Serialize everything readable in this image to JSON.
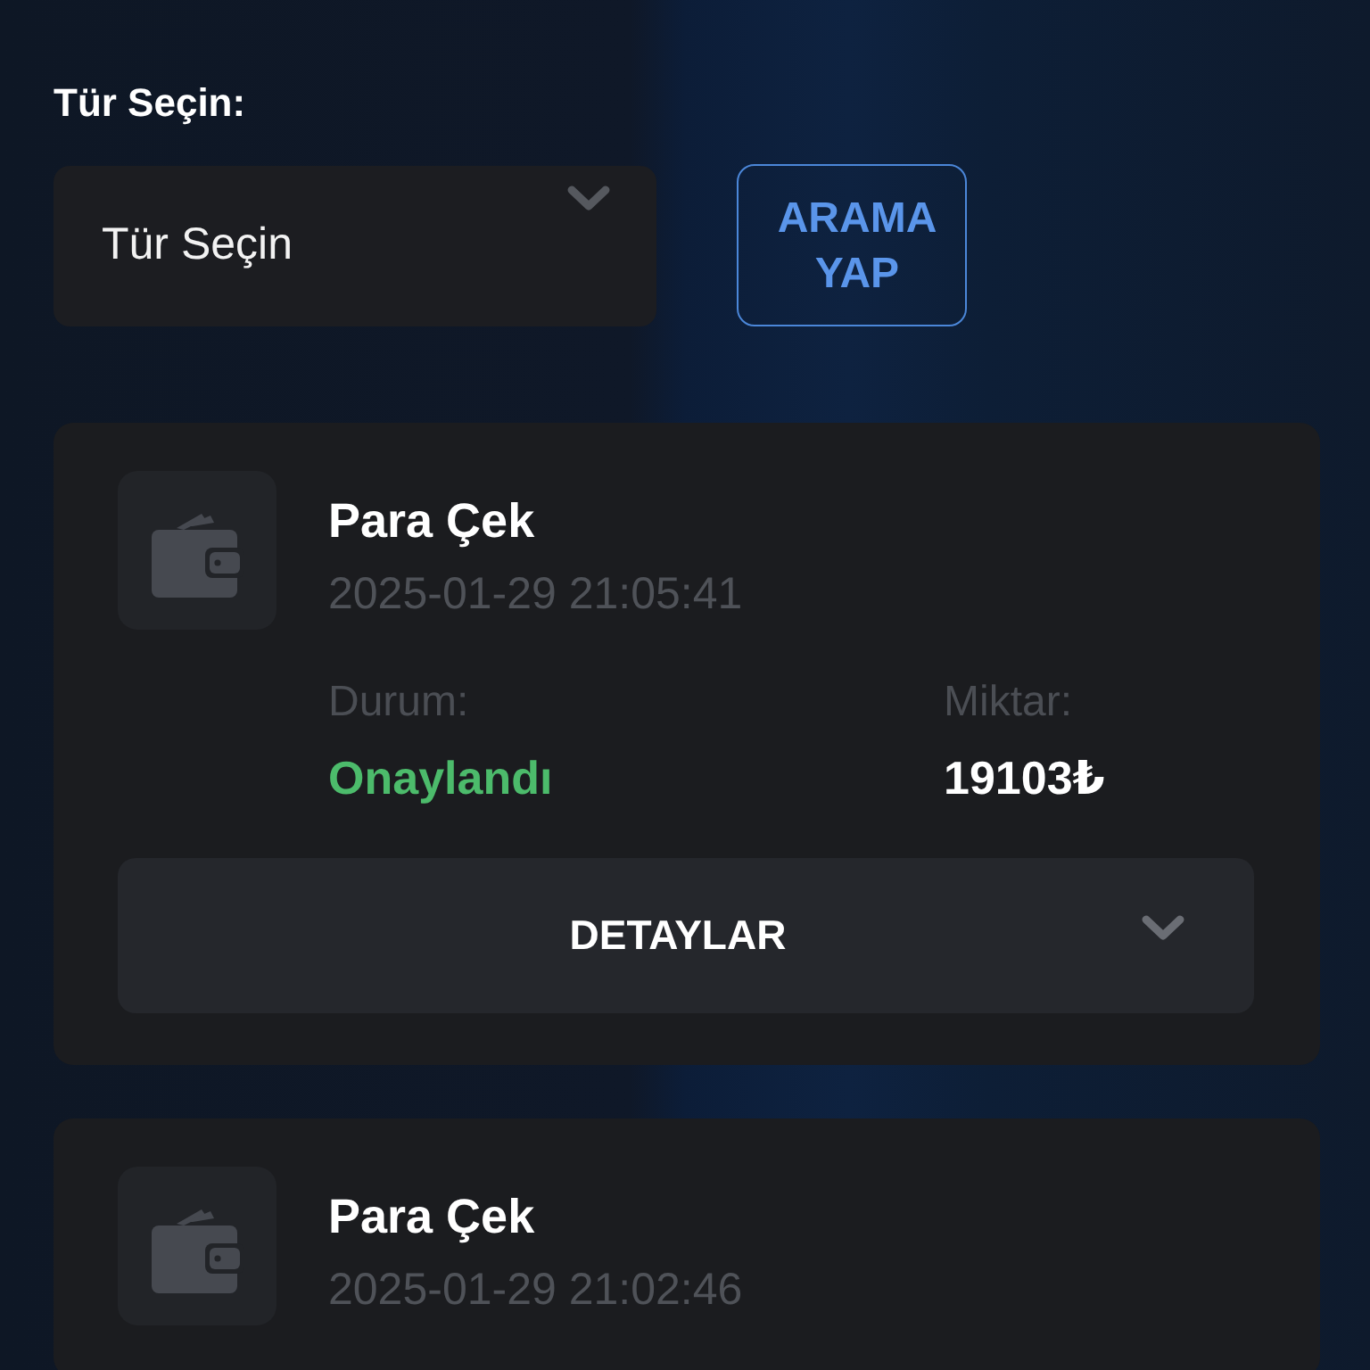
{
  "filter": {
    "label": "Tür Seçin:",
    "select": {
      "value": "Tür Seçin"
    },
    "search_button": "ARAMA YAP"
  },
  "transactions": [
    {
      "title": "Para Çek",
      "date": "2025-01-29 21:05:41",
      "status_label": "Durum:",
      "status": {
        "text": "Onaylandı",
        "color": "#4cbb6b"
      },
      "amount_label": "Miktar:",
      "amount": "19103₺",
      "details_button": "DETAYLAR",
      "expanded": false
    },
    {
      "title": "Para Çek",
      "date": "2025-01-29 21:02:46"
    }
  ]
}
